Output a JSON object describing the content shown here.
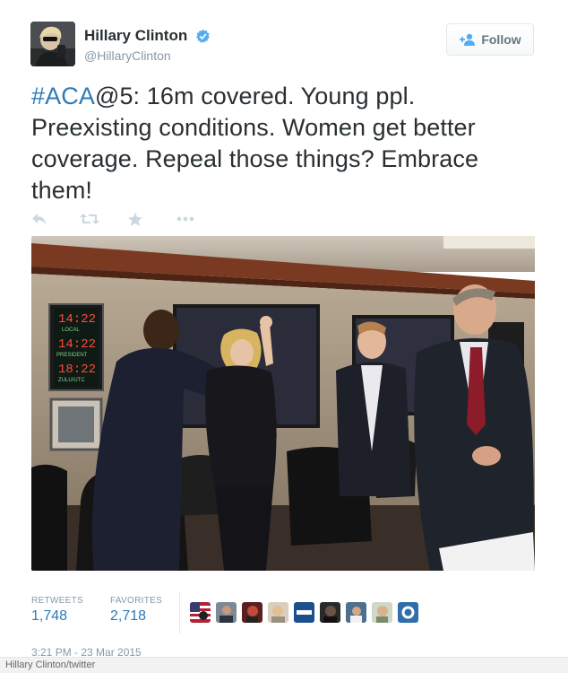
{
  "user": {
    "display_name": "Hillary Clinton",
    "handle": "@HillaryClinton",
    "avatar_icon": "avatar-photo"
  },
  "follow_button": {
    "label": "Follow",
    "icon": "add-person-icon"
  },
  "tweet": {
    "hashtag": "#ACA",
    "text": "@5: 16m covered. Young ppl. Preexisting conditions. Women get better coverage. Repeal those things? Embrace them!"
  },
  "actions": [
    {
      "name": "reply",
      "icon": "reply-icon"
    },
    {
      "name": "retweet",
      "icon": "retweet-icon"
    },
    {
      "name": "favorite",
      "icon": "star-icon"
    },
    {
      "name": "more",
      "icon": "more-icon"
    }
  ],
  "photo": {
    "clock_local": "14:22",
    "clock_local_label": "LOCAL",
    "clock_president": "14:22",
    "clock_president_label": "PRESIDENT",
    "clock_zulu": "18:22",
    "clock_zulu_label": "ZULU/UTC"
  },
  "stats": {
    "retweets_label": "RETWEETS",
    "retweets_value": "1,748",
    "favorites_label": "FAVORITES",
    "favorites_value": "2,718"
  },
  "favoriters_count_shown": 9,
  "timestamp": "3:21 PM - 23 Mar 2015",
  "credit": "Hillary Clinton/twitter",
  "colors": {
    "link": "#2b7bb9",
    "muted": "#8899a6",
    "text": "#292f33",
    "verified": "#55acee"
  }
}
